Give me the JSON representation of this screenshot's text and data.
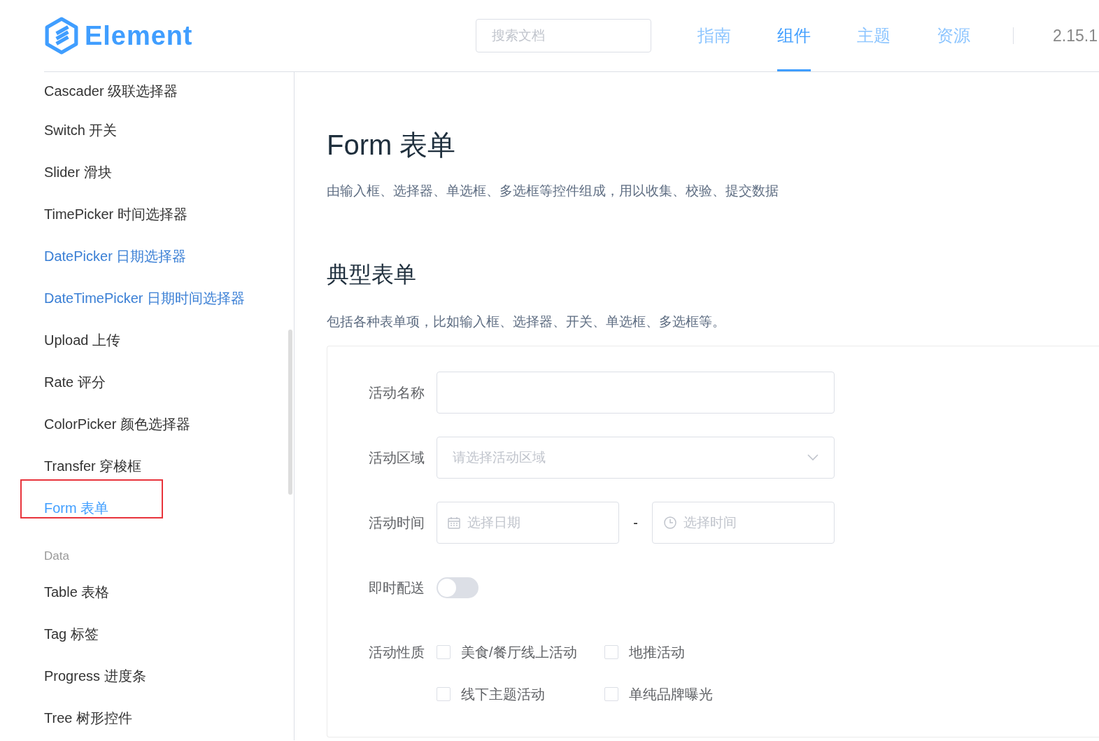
{
  "header": {
    "logo": "Element",
    "search": {
      "placeholder": "搜索文档"
    },
    "nav": [
      {
        "label": "指南",
        "selected": false
      },
      {
        "label": "组件",
        "selected": true
      },
      {
        "label": "主题",
        "selected": false
      },
      {
        "label": "资源",
        "selected": false
      }
    ],
    "version": "2.15.1"
  },
  "sidebar": {
    "items": [
      {
        "kind": "link",
        "label": "Cascader 级联选择器",
        "selected": false,
        "visited": false,
        "annotated": false
      },
      {
        "kind": "link",
        "label": "Switch 开关",
        "selected": false,
        "visited": false,
        "annotated": false
      },
      {
        "kind": "link",
        "label": "Slider 滑块",
        "selected": false,
        "visited": false,
        "annotated": false
      },
      {
        "kind": "link",
        "label": "TimePicker 时间选择器",
        "selected": false,
        "visited": false,
        "annotated": false
      },
      {
        "kind": "link",
        "label": "DatePicker 日期选择器",
        "selected": false,
        "visited": true,
        "annotated": false
      },
      {
        "kind": "link",
        "label": "DateTimePicker 日期时间选择器",
        "selected": false,
        "visited": true,
        "annotated": false
      },
      {
        "kind": "link",
        "label": "Upload 上传",
        "selected": false,
        "visited": false,
        "annotated": false
      },
      {
        "kind": "link",
        "label": "Rate 评分",
        "selected": false,
        "visited": false,
        "annotated": false
      },
      {
        "kind": "link",
        "label": "ColorPicker 颜色选择器",
        "selected": false,
        "visited": false,
        "annotated": false
      },
      {
        "kind": "link",
        "label": "Transfer 穿梭框",
        "selected": false,
        "visited": false,
        "annotated": false
      },
      {
        "kind": "link",
        "label": "Form 表单",
        "selected": true,
        "visited": false,
        "annotated": true
      },
      {
        "kind": "group",
        "label": "Data"
      },
      {
        "kind": "link",
        "label": "Table 表格",
        "selected": false,
        "visited": false,
        "annotated": false
      },
      {
        "kind": "link",
        "label": "Tag 标签",
        "selected": false,
        "visited": false,
        "annotated": false
      },
      {
        "kind": "link",
        "label": "Progress 进度条",
        "selected": false,
        "visited": false,
        "annotated": false
      },
      {
        "kind": "link",
        "label": "Tree 树形控件",
        "selected": false,
        "visited": false,
        "annotated": false
      }
    ]
  },
  "content": {
    "title": "Form 表单",
    "description": "由输入框、选择器、单选框、多选框等控件组成，用以收集、校验、提交数据",
    "section_title": "典型表单",
    "section_description": "包括各种表单项，比如输入框、选择器、开关、单选框、多选框等。",
    "form": [
      {
        "kind": "input",
        "label": "活动名称"
      },
      {
        "kind": "select",
        "label": "活动区域",
        "placeholder": "请选择活动区域"
      },
      {
        "kind": "datetime",
        "label": "活动时间",
        "date_placeholder": "选择日期",
        "separator": "-",
        "time_placeholder": "选择时间"
      },
      {
        "kind": "switch",
        "label": "即时配送",
        "on": false
      },
      {
        "kind": "checkboxes",
        "label": "活动性质",
        "options": [
          {
            "label": "美食/餐厅线上活动",
            "checked": false
          },
          {
            "label": "地推活动",
            "checked": false
          },
          {
            "label": "线下主题活动",
            "checked": false
          },
          {
            "label": "单纯品牌曝光",
            "checked": false
          }
        ]
      }
    ]
  }
}
